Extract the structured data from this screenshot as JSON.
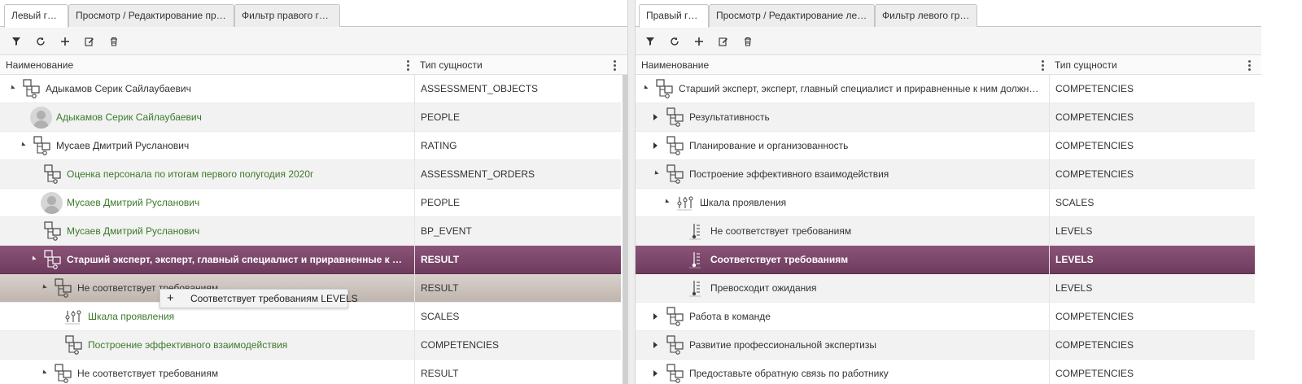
{
  "left": {
    "tabs": [
      "Левый грид",
      "Просмотр / Редактирование прав...",
      "Фильтр правого грида"
    ],
    "columns": {
      "name": "Наименование",
      "type": "Тип сущности"
    },
    "rows": [
      {
        "label": "Адыкамов Серик Сайлаубаевич",
        "type": "ASSESSMENT_OBJECTS",
        "icon": "tree-node-icon",
        "level": 0,
        "arrow": "open",
        "link": false
      },
      {
        "label": "Адыкамов Серик Сайлаубаевич",
        "type": "PEOPLE",
        "icon": "avatar",
        "level": 1,
        "arrow": "none",
        "link": true
      },
      {
        "label": "Мусаев Дмитрий Русланович",
        "type": "RATING",
        "icon": "tree-node-icon",
        "level": 1,
        "arrow": "open",
        "link": false
      },
      {
        "label": "Оценка персонала по итогам первого полугодия 2020г",
        "type": "ASSESSMENT_ORDERS",
        "icon": "tree-node-icon",
        "level": 2,
        "arrow": "none",
        "link": true
      },
      {
        "label": "Мусаев Дмитрий Русланович",
        "type": "PEOPLE",
        "icon": "avatar",
        "level": 2,
        "arrow": "none",
        "link": true
      },
      {
        "label": "Мусаев Дмитрий Русланович",
        "type": "BP_EVENT",
        "icon": "tree-node-icon",
        "level": 2,
        "arrow": "none",
        "link": true
      },
      {
        "label": "Старший эксперт, эксперт, главный специалист и приравненные к ним должност...",
        "type": "RESULT",
        "icon": "tree-node-icon",
        "level": 2,
        "arrow": "open",
        "link": false,
        "state": "selected"
      },
      {
        "label": "Не соответствует требованиям",
        "type": "RESULT",
        "icon": "tree-node-icon",
        "level": 3,
        "arrow": "open",
        "link": false,
        "state": "hover"
      },
      {
        "label": "Шкала проявления",
        "type": "SCALES",
        "icon": "scale-icon",
        "level": 4,
        "arrow": "none",
        "link": true
      },
      {
        "label": "Построение эффективного взаимодействия",
        "type": "COMPETENCIES",
        "icon": "tree-node-icon",
        "level": 4,
        "arrow": "none",
        "link": true
      },
      {
        "label": "Не соответствует требованиям",
        "type": "RESULT",
        "icon": "tree-node-icon",
        "level": 3,
        "arrow": "open",
        "link": false
      }
    ],
    "drag_tooltip": {
      "plus": "+",
      "text": "Соответствует требованиям LEVELS"
    }
  },
  "right": {
    "tabs": [
      "Правый грид",
      "Просмотр / Редактирование левог...",
      "Фильтр левого грида"
    ],
    "columns": {
      "name": "Наименование",
      "type": "Тип сущности"
    },
    "rows": [
      {
        "label": "Старший эксперт, эксперт, главный специалист и приравненные к ним должности",
        "type": "COMPETENCIES",
        "icon": "tree-node-icon",
        "level": 0,
        "arrow": "open",
        "link": false
      },
      {
        "label": "Результативность",
        "type": "COMPETENCIES",
        "icon": "tree-node-icon",
        "level": 1,
        "arrow": "closed",
        "link": false
      },
      {
        "label": "Планирование и организованность",
        "type": "COMPETENCIES",
        "icon": "tree-node-icon",
        "level": 1,
        "arrow": "closed",
        "link": false
      },
      {
        "label": "Построение эффективного взаимодействия",
        "type": "COMPETENCIES",
        "icon": "tree-node-icon",
        "level": 1,
        "arrow": "open",
        "link": false
      },
      {
        "label": "Шкала проявления",
        "type": "SCALES",
        "icon": "scale-icon",
        "level": 2,
        "arrow": "open",
        "link": false
      },
      {
        "label": "Не соответствует требованиям",
        "type": "LEVELS",
        "icon": "level-icon",
        "level": 3,
        "arrow": "none",
        "link": false
      },
      {
        "label": "Соответствует требованиям",
        "type": "LEVELS",
        "icon": "level-icon",
        "level": 3,
        "arrow": "none",
        "link": false,
        "state": "selected"
      },
      {
        "label": "Превосходит ожидания",
        "type": "LEVELS",
        "icon": "level-icon",
        "level": 3,
        "arrow": "none",
        "link": false
      },
      {
        "label": "Работа в команде",
        "type": "COMPETENCIES",
        "icon": "tree-node-icon",
        "level": 1,
        "arrow": "closed",
        "link": false
      },
      {
        "label": "Развитие профессиональной экспертизы",
        "type": "COMPETENCIES",
        "icon": "tree-node-icon",
        "level": 1,
        "arrow": "closed",
        "link": false
      },
      {
        "label": "Предоставьте обратную связь по работнику",
        "type": "COMPETENCIES",
        "icon": "tree-node-icon",
        "level": 1,
        "arrow": "closed",
        "link": false
      }
    ]
  },
  "toolbar_icons": [
    "filter-icon",
    "refresh-icon",
    "add-icon",
    "edit-icon",
    "delete-icon"
  ]
}
